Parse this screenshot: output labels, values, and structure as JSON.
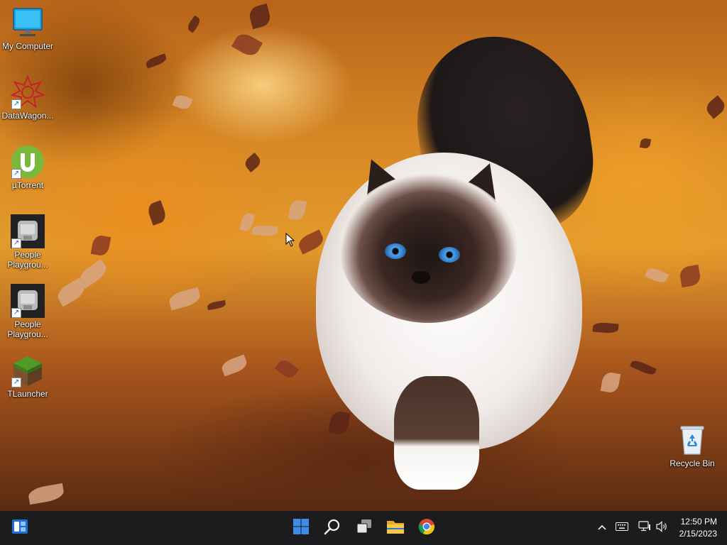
{
  "desktop": {
    "icons": [
      {
        "label": "My Computer",
        "icon": "monitor-icon"
      },
      {
        "label": "DataWagon...",
        "icon": "datawagon-icon",
        "shortcut": true
      },
      {
        "label": "µTorrent",
        "icon": "utorrent-icon",
        "shortcut": true
      },
      {
        "label": "People Playgrou...",
        "icon": "people-playground-icon",
        "shortcut": true
      },
      {
        "label": "People Playgrou...",
        "icon": "people-playground-icon",
        "shortcut": true
      },
      {
        "label": "TLauncher",
        "icon": "tlauncher-icon",
        "shortcut": true
      },
      {
        "label": "Recycle Bin",
        "icon": "recycle-bin-icon"
      }
    ]
  },
  "taskbar": {
    "widgets_icon": "widgets-icon",
    "pinned": [
      {
        "name": "Start",
        "icon": "windows-start-icon"
      },
      {
        "name": "Search",
        "icon": "search-icon"
      },
      {
        "name": "Task View",
        "icon": "task-view-icon"
      },
      {
        "name": "File Explorer",
        "icon": "folder-icon"
      },
      {
        "name": "Google Chrome",
        "icon": "chrome-icon"
      }
    ],
    "tray": {
      "overflow_icon": "chevron-up-icon",
      "keyboard_icon": "keyboard-icon",
      "network_icon": "network-icon",
      "volume_icon": "speaker-icon",
      "time": "12:50 PM",
      "date": "2/15/2023"
    },
    "colors": {
      "taskbar_bg": "#1c1c1e",
      "accent": "#3a8ee6"
    }
  }
}
